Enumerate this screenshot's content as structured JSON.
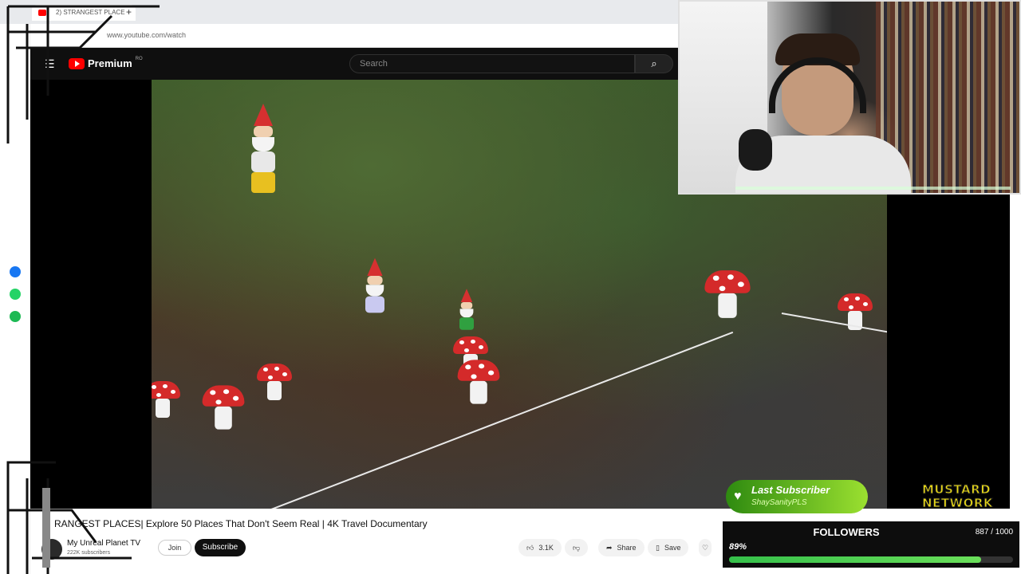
{
  "browser": {
    "tab_title": "2) STRANGEST PLACE",
    "new_tab": "+",
    "url": "www.youtube.com/watch"
  },
  "youtube": {
    "menu_glyph": "☰",
    "logo_text": "Premium",
    "logo_region": "RO",
    "search_placeholder": "Search",
    "search_glyph": "⌕"
  },
  "video": {
    "title": "RANGEST PLACES| Explore 50 Places That Don't Seem Real | 4K Travel Documentary",
    "channel_name": "My Unreal Planet TV",
    "channel_subs": "222K subscribers",
    "join_label": "Join",
    "subscribe_label": "Subscribe",
    "like_count": "3.1K",
    "share_label": "Share",
    "save_label": "Save"
  },
  "overlay": {
    "last_sub_title": "Last Subscriber",
    "last_sub_name": "ShaySanityPLS",
    "brand_line1": "MUSTARD",
    "brand_line2": "NETWORK",
    "followers_title": "FOLLOWERS",
    "followers_count": "887 / 1000",
    "followers_pct_label": "89%",
    "followers_progress": 0.887
  },
  "colors": {
    "yt_red": "#ff0000",
    "yt_dark": "#0f0f0f",
    "overlay_green": "#35c04a",
    "mustard": "#e8d818"
  }
}
